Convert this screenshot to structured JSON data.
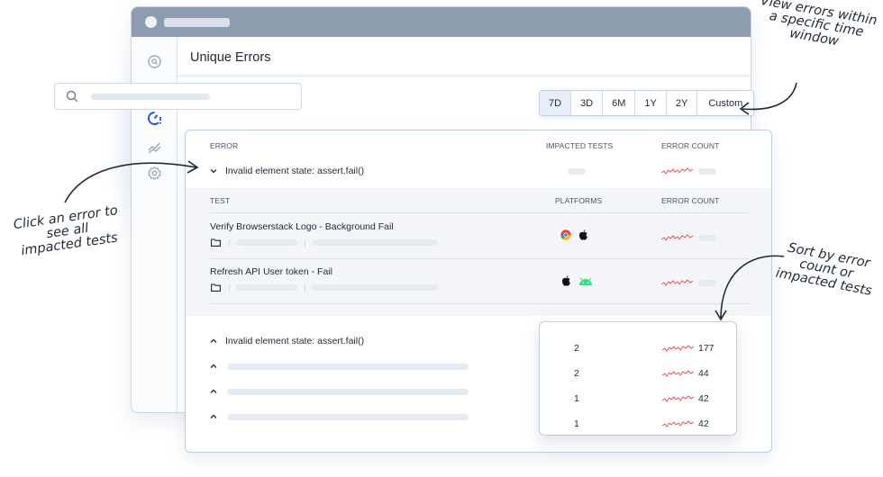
{
  "page": {
    "title": "Unique Errors"
  },
  "search": {
    "placeholder": ""
  },
  "time_ranges": {
    "options": [
      "7D",
      "3D",
      "6M",
      "1Y",
      "2Y",
      "Custom"
    ],
    "selected": "7D"
  },
  "sidebar": {
    "items": [
      "search-icon",
      "loading-icon",
      "unique-errors-icon",
      "trends-icon",
      "settings-icon"
    ],
    "active": "unique-errors-icon"
  },
  "errors_table": {
    "headers": {
      "error": "ERROR",
      "impacted_tests": "IMPACTED TESTS",
      "error_count": "ERROR COUNT"
    },
    "expanded_error": {
      "label": "Invalid element state: assert.fail()"
    },
    "tests_table": {
      "headers": {
        "test": "TEST",
        "platforms": "PLATFORMS",
        "error_count": "ERROR COUNT"
      },
      "rows": [
        {
          "name": "Verify Browserstack Logo - Background Fail",
          "platforms": [
            "chrome-icon",
            "apple-icon"
          ]
        },
        {
          "name": "Refresh API User token - Fail",
          "platforms": [
            "apple-icon",
            "android-icon"
          ]
        }
      ]
    },
    "collapsed_error": {
      "label": "Invalid element state: assert.fail()"
    }
  },
  "sort_popup": {
    "rows": [
      {
        "impacted_tests": "2",
        "error_count": "177"
      },
      {
        "impacted_tests": "2",
        "error_count": "44"
      },
      {
        "impacted_tests": "1",
        "error_count": "42"
      },
      {
        "impacted_tests": "1",
        "error_count": "42"
      }
    ]
  },
  "annotations": {
    "left": "Click an error to see all impacted tests",
    "top": "View errors within a specific time window",
    "right": "Sort by error count or impacted tests"
  },
  "colors": {
    "titlebar": "#8d9cb1",
    "accent": "#1d4ed8",
    "spark": "#ef4444",
    "border": "#bfccdc"
  }
}
